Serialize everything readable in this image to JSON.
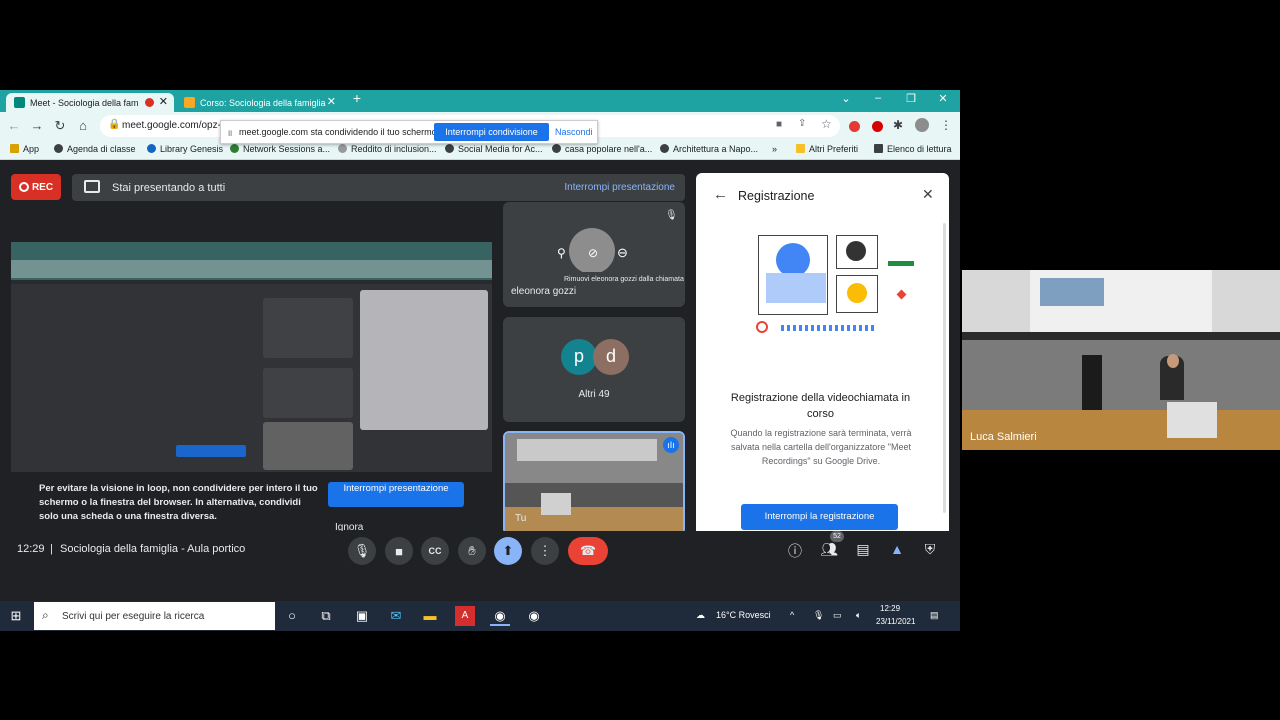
{
  "browser": {
    "tabs": [
      {
        "label": "Meet - Sociologia della fam",
        "active": true
      },
      {
        "label": "Corso: Sociologia della famiglia",
        "active": false
      }
    ],
    "url": "meet.google.com/opz-",
    "share_banner": {
      "text": "meet.google.com sta condividendo il tuo schermo.",
      "stop_label": "Interrompi condivisione",
      "hide_label": "Nascondi"
    },
    "bookmarks": [
      "App",
      "Agenda di classe",
      "Library Genesis",
      "Network Sessions a...",
      "Reddito di inclusion...",
      "Social Media for Ac...",
      "casa popolare nell'a...",
      "Architettura a Napo...",
      "»",
      "Altri Preferiti",
      "Elenco di lettura"
    ]
  },
  "meet": {
    "rec_label": "REC",
    "presenting_text": "Stai presentando a tutti",
    "stop_presenting_link": "Interrompi presentazione",
    "participants": {
      "eleonora": {
        "name": "eleonora gozzi",
        "tooltip": "Rimuovi eleonora gozzi dalla chiamata"
      },
      "others": {
        "label": "Altri 49",
        "avatar1": "p",
        "avatar2": "d"
      },
      "self": {
        "label": "Tu"
      }
    },
    "loop_warning": "Per evitare la visione in loop, non condividere per intero il tuo schermo o la finestra del browser. In alternativa, condividi solo una scheda o una finestra diversa.",
    "stop_present_button": "Interrompi presentazione",
    "ignore_label": "Ignora",
    "recording_panel": {
      "title": "Registrazione",
      "heading": "Registrazione della videochiamata in corso",
      "description": "Quando la registrazione sarà terminata, verrà salvata nella cartella dell'organizzatore \"Meet Recordings\" su Google Drive.",
      "stop_button": "Interrompi la registrazione"
    },
    "controls": {
      "time": "12:29",
      "separator": "|",
      "meeting_title": "Sociologia della famiglia - Aula portico",
      "participants_count": "52"
    },
    "colors": {
      "accent": "#1a73e8",
      "rec": "#d93025",
      "end_call": "#ea4335",
      "dark_bg": "#202124"
    }
  },
  "taskbar": {
    "search_placeholder": "Scrivi qui per eseguire la ricerca",
    "weather": "16°C  Rovesci",
    "clock_time": "12:29",
    "clock_date": "23/11/2021"
  },
  "camera": {
    "name": "Luca Salmieri"
  }
}
